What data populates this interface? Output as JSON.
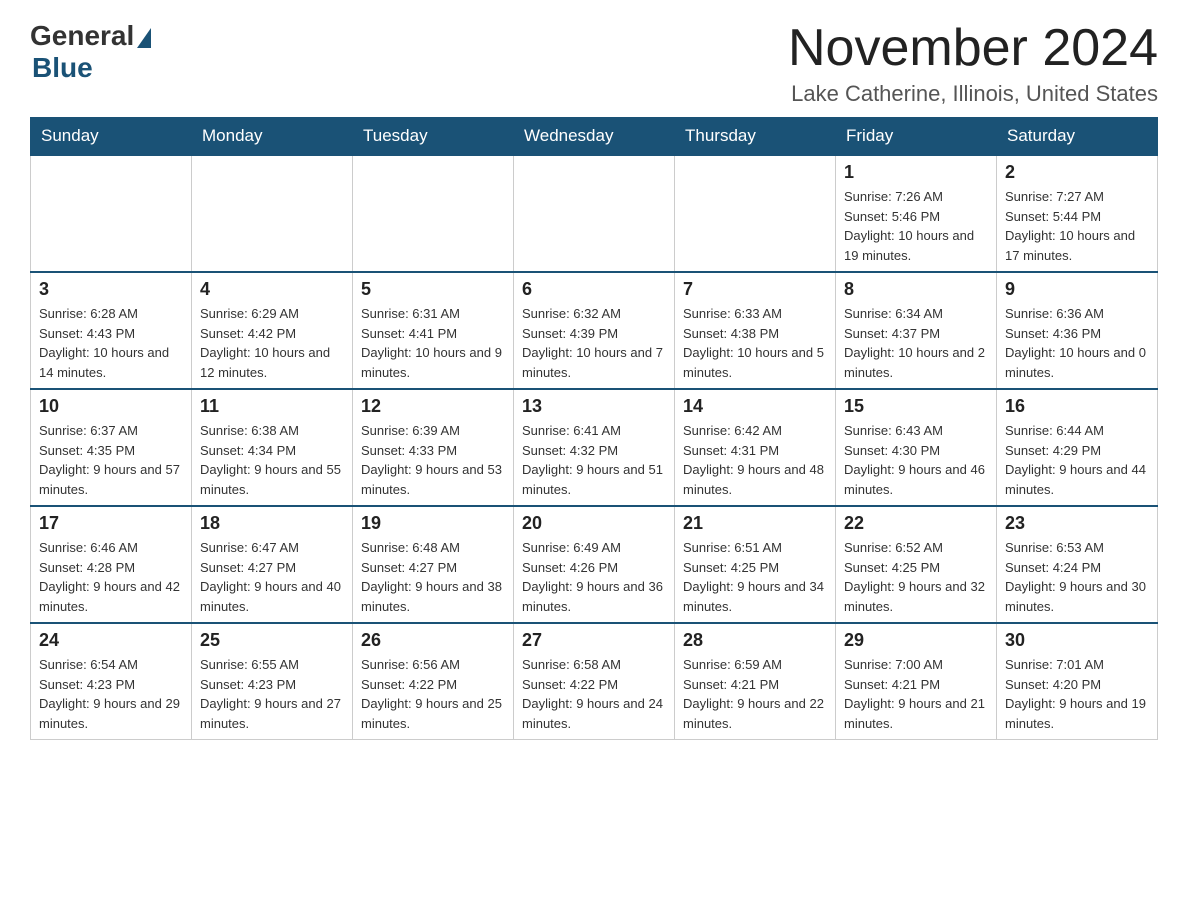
{
  "logo": {
    "general": "General",
    "blue": "Blue"
  },
  "header": {
    "month_year": "November 2024",
    "location": "Lake Catherine, Illinois, United States"
  },
  "weekdays": [
    "Sunday",
    "Monday",
    "Tuesday",
    "Wednesday",
    "Thursday",
    "Friday",
    "Saturday"
  ],
  "weeks": [
    [
      {
        "day": "",
        "info": ""
      },
      {
        "day": "",
        "info": ""
      },
      {
        "day": "",
        "info": ""
      },
      {
        "day": "",
        "info": ""
      },
      {
        "day": "",
        "info": ""
      },
      {
        "day": "1",
        "info": "Sunrise: 7:26 AM\nSunset: 5:46 PM\nDaylight: 10 hours and 19 minutes."
      },
      {
        "day": "2",
        "info": "Sunrise: 7:27 AM\nSunset: 5:44 PM\nDaylight: 10 hours and 17 minutes."
      }
    ],
    [
      {
        "day": "3",
        "info": "Sunrise: 6:28 AM\nSunset: 4:43 PM\nDaylight: 10 hours and 14 minutes."
      },
      {
        "day": "4",
        "info": "Sunrise: 6:29 AM\nSunset: 4:42 PM\nDaylight: 10 hours and 12 minutes."
      },
      {
        "day": "5",
        "info": "Sunrise: 6:31 AM\nSunset: 4:41 PM\nDaylight: 10 hours and 9 minutes."
      },
      {
        "day": "6",
        "info": "Sunrise: 6:32 AM\nSunset: 4:39 PM\nDaylight: 10 hours and 7 minutes."
      },
      {
        "day": "7",
        "info": "Sunrise: 6:33 AM\nSunset: 4:38 PM\nDaylight: 10 hours and 5 minutes."
      },
      {
        "day": "8",
        "info": "Sunrise: 6:34 AM\nSunset: 4:37 PM\nDaylight: 10 hours and 2 minutes."
      },
      {
        "day": "9",
        "info": "Sunrise: 6:36 AM\nSunset: 4:36 PM\nDaylight: 10 hours and 0 minutes."
      }
    ],
    [
      {
        "day": "10",
        "info": "Sunrise: 6:37 AM\nSunset: 4:35 PM\nDaylight: 9 hours and 57 minutes."
      },
      {
        "day": "11",
        "info": "Sunrise: 6:38 AM\nSunset: 4:34 PM\nDaylight: 9 hours and 55 minutes."
      },
      {
        "day": "12",
        "info": "Sunrise: 6:39 AM\nSunset: 4:33 PM\nDaylight: 9 hours and 53 minutes."
      },
      {
        "day": "13",
        "info": "Sunrise: 6:41 AM\nSunset: 4:32 PM\nDaylight: 9 hours and 51 minutes."
      },
      {
        "day": "14",
        "info": "Sunrise: 6:42 AM\nSunset: 4:31 PM\nDaylight: 9 hours and 48 minutes."
      },
      {
        "day": "15",
        "info": "Sunrise: 6:43 AM\nSunset: 4:30 PM\nDaylight: 9 hours and 46 minutes."
      },
      {
        "day": "16",
        "info": "Sunrise: 6:44 AM\nSunset: 4:29 PM\nDaylight: 9 hours and 44 minutes."
      }
    ],
    [
      {
        "day": "17",
        "info": "Sunrise: 6:46 AM\nSunset: 4:28 PM\nDaylight: 9 hours and 42 minutes."
      },
      {
        "day": "18",
        "info": "Sunrise: 6:47 AM\nSunset: 4:27 PM\nDaylight: 9 hours and 40 minutes."
      },
      {
        "day": "19",
        "info": "Sunrise: 6:48 AM\nSunset: 4:27 PM\nDaylight: 9 hours and 38 minutes."
      },
      {
        "day": "20",
        "info": "Sunrise: 6:49 AM\nSunset: 4:26 PM\nDaylight: 9 hours and 36 minutes."
      },
      {
        "day": "21",
        "info": "Sunrise: 6:51 AM\nSunset: 4:25 PM\nDaylight: 9 hours and 34 minutes."
      },
      {
        "day": "22",
        "info": "Sunrise: 6:52 AM\nSunset: 4:25 PM\nDaylight: 9 hours and 32 minutes."
      },
      {
        "day": "23",
        "info": "Sunrise: 6:53 AM\nSunset: 4:24 PM\nDaylight: 9 hours and 30 minutes."
      }
    ],
    [
      {
        "day": "24",
        "info": "Sunrise: 6:54 AM\nSunset: 4:23 PM\nDaylight: 9 hours and 29 minutes."
      },
      {
        "day": "25",
        "info": "Sunrise: 6:55 AM\nSunset: 4:23 PM\nDaylight: 9 hours and 27 minutes."
      },
      {
        "day": "26",
        "info": "Sunrise: 6:56 AM\nSunset: 4:22 PM\nDaylight: 9 hours and 25 minutes."
      },
      {
        "day": "27",
        "info": "Sunrise: 6:58 AM\nSunset: 4:22 PM\nDaylight: 9 hours and 24 minutes."
      },
      {
        "day": "28",
        "info": "Sunrise: 6:59 AM\nSunset: 4:21 PM\nDaylight: 9 hours and 22 minutes."
      },
      {
        "day": "29",
        "info": "Sunrise: 7:00 AM\nSunset: 4:21 PM\nDaylight: 9 hours and 21 minutes."
      },
      {
        "day": "30",
        "info": "Sunrise: 7:01 AM\nSunset: 4:20 PM\nDaylight: 9 hours and 19 minutes."
      }
    ]
  ]
}
